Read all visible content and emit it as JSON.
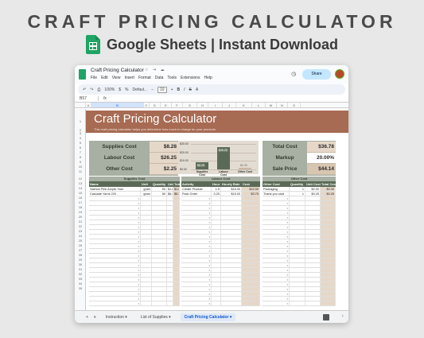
{
  "banner": {
    "title": "CRAFT PRICING CALCULATOR",
    "subtitle": "Google Sheets | Instant Download"
  },
  "doc": {
    "title": "Craft Pricing Calculator",
    "menus": [
      "File",
      "Edit",
      "View",
      "Insert",
      "Format",
      "Data",
      "Tools",
      "Extensions",
      "Help"
    ],
    "share_label": "Share",
    "zoom": "100%",
    "font_name": "Defaul...",
    "font_size": "10",
    "cell_ref": "B57",
    "fx": "fx",
    "columns": [
      "A",
      "B",
      "C",
      "D",
      "E",
      "F",
      "G",
      "H",
      "I",
      "J",
      "K",
      "L",
      "M",
      "N",
      "O"
    ]
  },
  "sheet": {
    "title": "Craft Pricing Calculator",
    "description": "This craft pricing calculator helps you determine how much to charge for your products",
    "summary_left": [
      {
        "label": "Supplies Cost",
        "value": "$8.28"
      },
      {
        "label": "Labour Cost",
        "value": "$26.25"
      },
      {
        "label": "Other Cost",
        "value": "$2.25"
      }
    ],
    "summary_right": [
      {
        "label": "Total Cost",
        "value": "$36.78"
      },
      {
        "label": "Markup",
        "value": "20.00%"
      },
      {
        "label": "Sale Price",
        "value": "$44.14"
      }
    ],
    "supplies": {
      "title": "Supplies Cost",
      "headers": [
        "Name",
        "Unit",
        "Quantity",
        "Unit Cost",
        "Total Cost"
      ],
      "rows": [
        [
          "Salmon Pink Acrylic Yarn",
          "gram",
          "50",
          "$1.80",
          "$1.80"
        ],
        [
          "Cascade Yarns 220",
          "gram",
          "80",
          "$6.39",
          "$6.39"
        ]
      ]
    },
    "labour": {
      "title": "Labour Cost",
      "headers": [
        "Activity",
        "Hour",
        "Hourly Rate",
        "Cost"
      ],
      "rows": [
        [
          "Create Product",
          "1.5",
          "$15.00",
          "$22.50"
        ],
        [
          "Pack Order",
          "0.25",
          "$15.00",
          "$3.75"
        ]
      ]
    },
    "other": {
      "title": "Other Cost",
      "headers": [
        "Other Cost",
        "Quantity",
        "Unit Cost",
        "Total Cost"
      ],
      "rows": [
        [
          "Packaging",
          "1",
          "$2.00",
          "$2.00"
        ],
        [
          "Thank you card",
          "1",
          "$0.25",
          "$0.25"
        ]
      ]
    }
  },
  "chart_data": {
    "type": "bar",
    "categories": [
      "Supplies Cost",
      "Labour Cost",
      "Other Cost"
    ],
    "values": [
      8.28,
      26.25,
      2.25
    ],
    "value_labels": [
      "$8.28",
      "$26.25",
      "$2.25"
    ],
    "y_ticks": [
      "$30.00",
      "$20.00",
      "$10.00",
      "$0.00"
    ],
    "ylim": [
      0,
      30
    ],
    "colors": [
      "#5b6a57",
      "#5b6a57",
      "#c9b8a5"
    ]
  },
  "row_numbers": [
    "1",
    "2",
    "3",
    "4",
    "5",
    "6",
    "7",
    "8",
    "9",
    "10",
    "11",
    "12",
    "13",
    "14",
    "15",
    "16",
    "17",
    "18",
    "19",
    "20",
    "21",
    "22",
    "23",
    "24",
    "25",
    "26",
    "27",
    "28",
    "29",
    "30",
    "31",
    "32",
    "33",
    "34",
    "35"
  ],
  "tabs": {
    "add": "+",
    "all": "≡",
    "items": [
      "Instruction",
      "List of Supplies",
      "Craft Pricing Calculator"
    ],
    "active": 2
  }
}
